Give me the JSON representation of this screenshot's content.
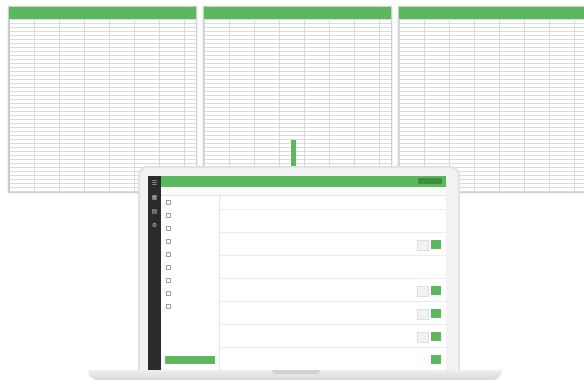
{
  "sheets": [
    {
      "id": "left"
    },
    {
      "id": "middle"
    },
    {
      "id": "right"
    }
  ],
  "colors": {
    "accent": "#5cb85c",
    "rail": "#2b2b2b"
  },
  "icons": [
    "arrow-down-icon",
    "laptop-icon"
  ],
  "laptop": {
    "topbar": {
      "title": ""
    },
    "nav": {
      "items": [
        "",
        "",
        "",
        ""
      ]
    },
    "sidebar": {
      "items": [
        "",
        "",
        "",
        "",
        "",
        "",
        "",
        "",
        "",
        ""
      ],
      "button": ""
    },
    "main": {
      "title": "",
      "tasks": [
        {
          "title": "",
          "meta": "",
          "has_grey": false,
          "has_green": false
        },
        {
          "title": "",
          "meta": "",
          "has_grey": true,
          "has_green": true
        },
        {
          "title": "",
          "meta": "",
          "has_grey": false,
          "has_green": false
        },
        {
          "title": "",
          "meta": "",
          "has_grey": true,
          "has_green": true
        },
        {
          "title": "",
          "meta": "",
          "has_grey": true,
          "has_green": true
        },
        {
          "title": "",
          "meta": "",
          "has_grey": true,
          "has_green": true
        },
        {
          "title": "",
          "meta": "",
          "has_grey": true,
          "has_green": true
        }
      ]
    }
  }
}
